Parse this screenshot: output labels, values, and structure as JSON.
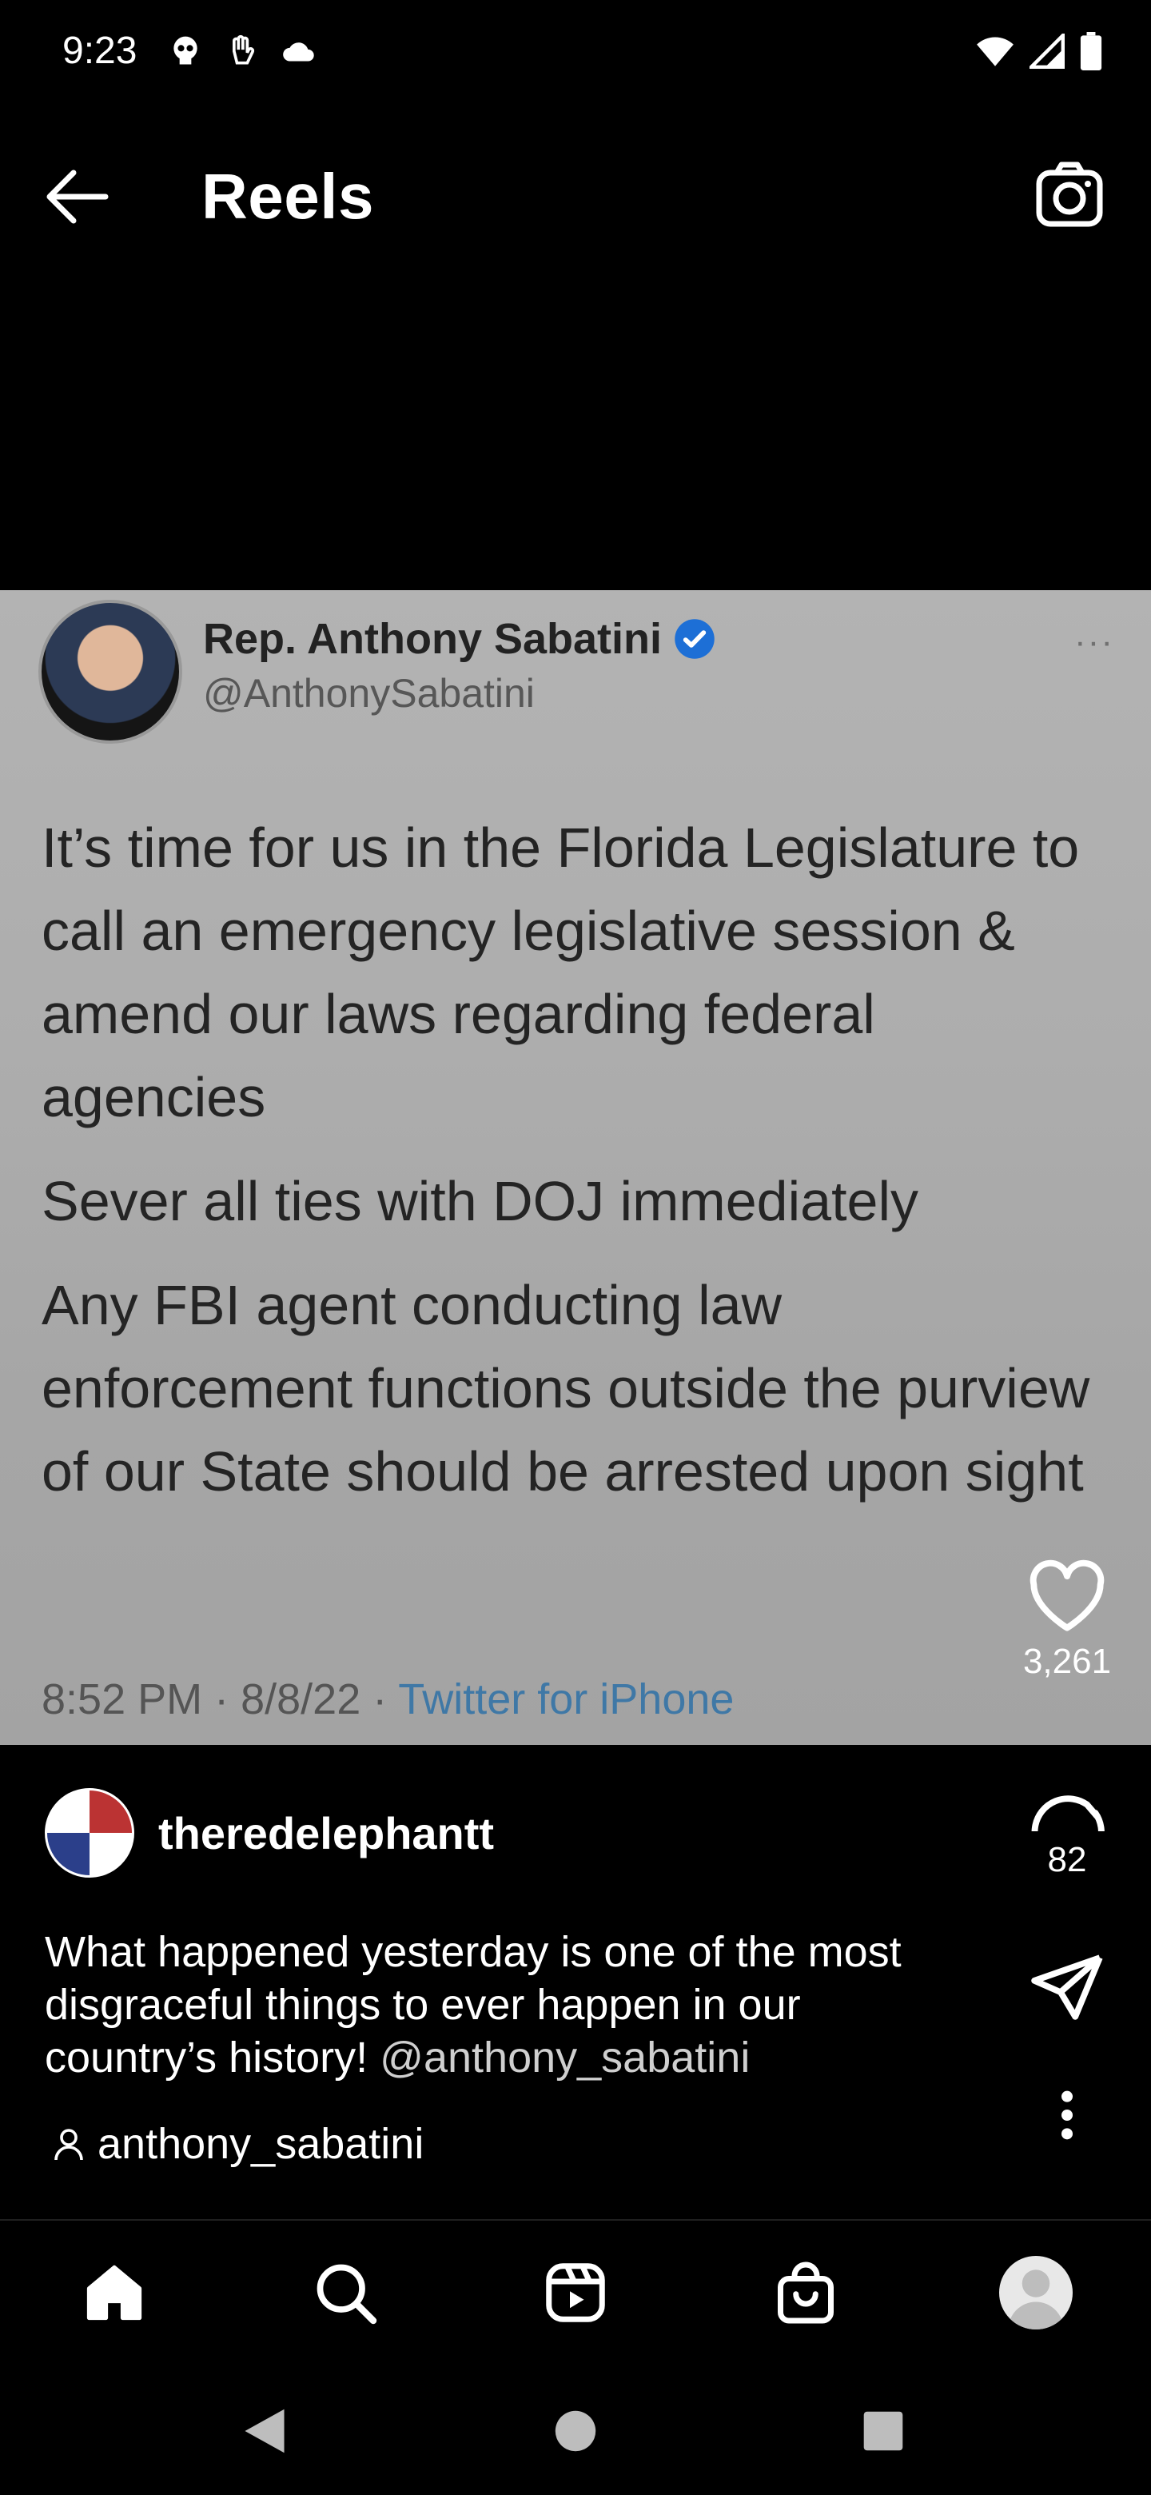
{
  "status_bar": {
    "time": "9:23"
  },
  "header": {
    "title": "Reels"
  },
  "tweet": {
    "name": "Rep. Anthony Sabatini",
    "handle": "@AnthonySabatini",
    "more": "···",
    "paragraphs": [
      "It’s time for us in the Florida Legislature to call an emergency legislative session & amend our laws regarding federal agencies",
      "Sever all ties with DOJ immediately",
      "Any FBI agent conducting law enforcement functions outside the purview of our State should be arrested upon sight"
    ],
    "meta_time": "8:52 PM · 8/8/22 · ",
    "meta_source": "Twitter for iPhone"
  },
  "actions": {
    "likes": "3,261",
    "comments": "82"
  },
  "post": {
    "username": "theredelephantt",
    "caption": "What happened yesterday is one of the most disgraceful things to ever happen in our country’s history! ",
    "caption_mention": "@anthony_sabatini",
    "tagged_user": "anthony_sabatini"
  },
  "colors": {
    "background": "#000000",
    "tweet_bg": "#adadad",
    "link": "#3f78a6",
    "verified": "#1d6fd6"
  }
}
